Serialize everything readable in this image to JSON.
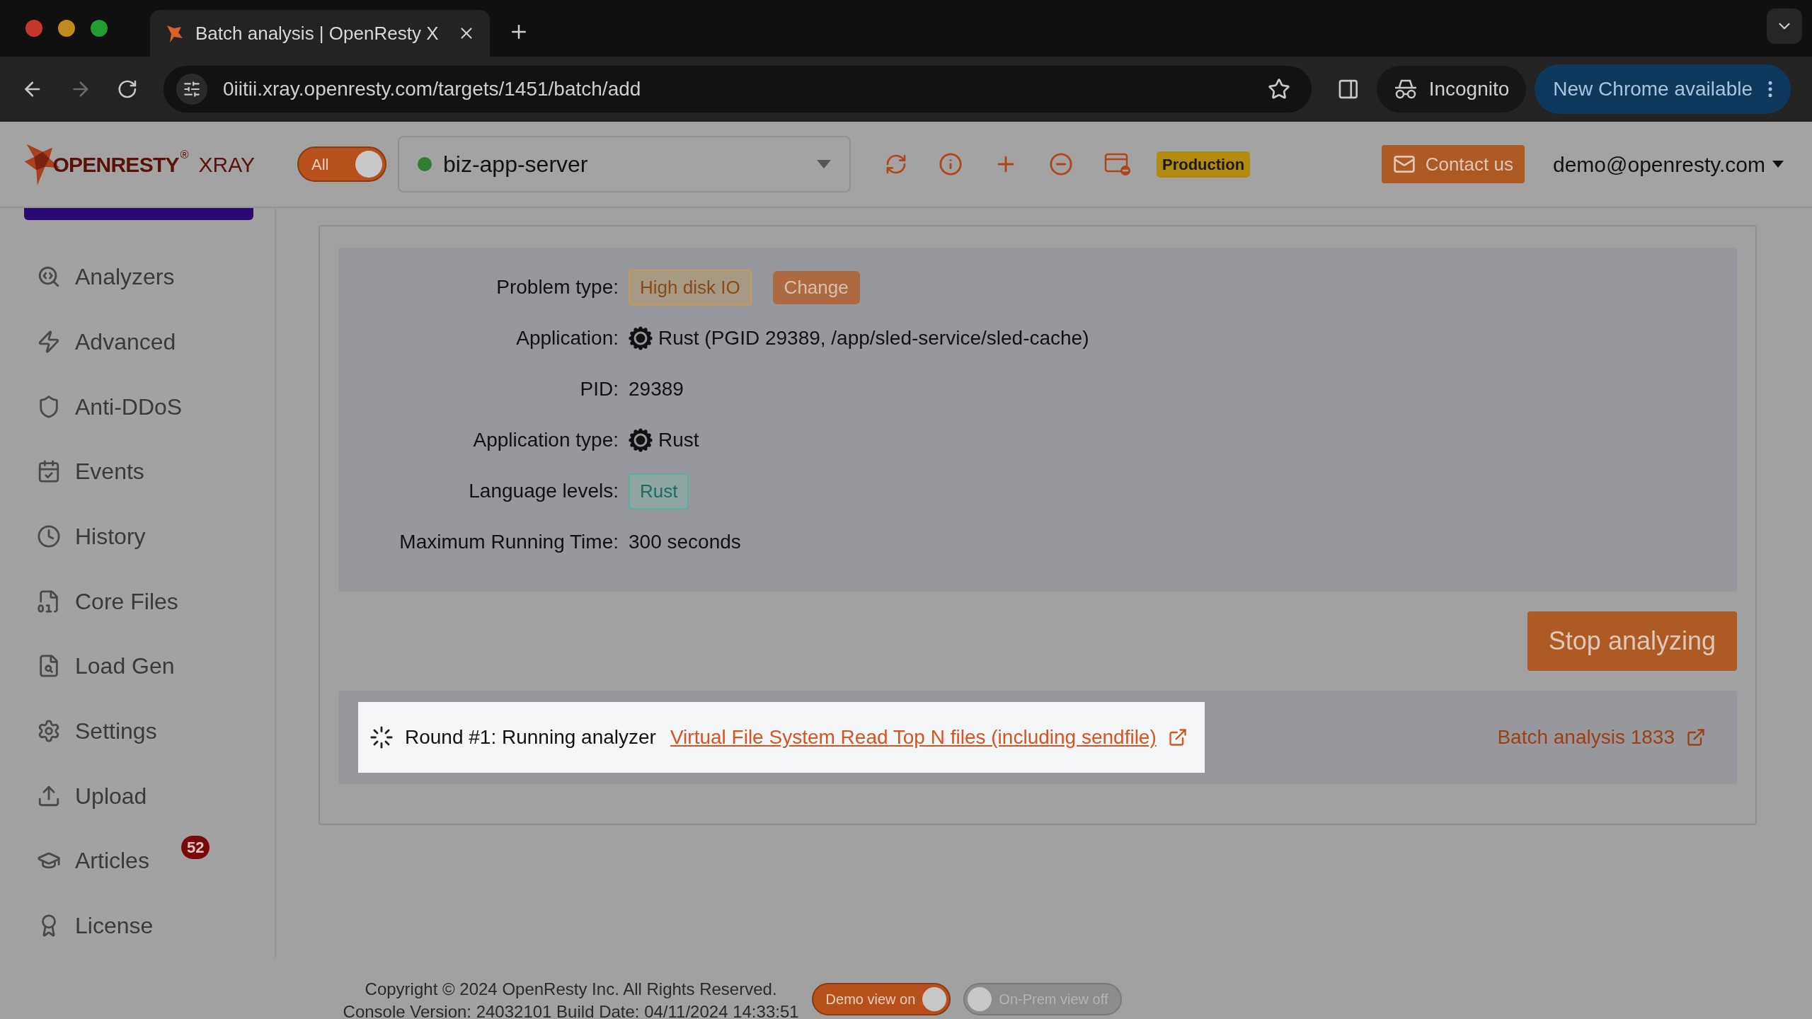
{
  "browser": {
    "tab_title": "Batch analysis | OpenResty X",
    "url": "0iitii.xray.openresty.com/targets/1451/batch/add",
    "profile": "Incognito",
    "update_button": "New Chrome available"
  },
  "header": {
    "logo": {
      "brand": "OPENRESTY",
      "mark": "®",
      "product": "XRAY"
    },
    "scope_toggle": {
      "label": "All",
      "on": true
    },
    "server": {
      "name": "biz-app-server",
      "color": "#2e7d32"
    },
    "environment": "Production",
    "contact": "Contact us",
    "user": "demo@openresty.com"
  },
  "sidebar": {
    "items": [
      {
        "label": "Analyzers"
      },
      {
        "label": "Advanced"
      },
      {
        "label": "Anti-DDoS"
      },
      {
        "label": "Events"
      },
      {
        "label": "History"
      },
      {
        "label": "Core Files"
      },
      {
        "label": "Load Gen"
      },
      {
        "label": "Settings"
      },
      {
        "label": "Upload"
      },
      {
        "label": "Articles",
        "badge": "52"
      },
      {
        "label": "License"
      }
    ]
  },
  "details": [
    {
      "label": "Problem type:",
      "kind": "warning_tag",
      "value": "High disk IO",
      "action": "Change"
    },
    {
      "label": "Application:",
      "kind": "lang_icon",
      "value": "Rust (PGID 29389, /app/sled-service/sled-cache)"
    },
    {
      "label": "PID:",
      "kind": "text",
      "value": "29389"
    },
    {
      "label": "Application type:",
      "kind": "lang_icon",
      "value": "Rust"
    },
    {
      "label": "Language levels:",
      "kind": "lang_tag",
      "value": "Rust"
    },
    {
      "label": "Maximum Running Time:",
      "kind": "text",
      "value": "300 seconds"
    }
  ],
  "stop_button": "Stop analyzing",
  "progress": {
    "highlighted": true,
    "status": "Round #1: Running analyzer",
    "analyzer_link": "Virtual File System Read Top N files (including sendfile)",
    "batch_link": "Batch analysis 1833"
  },
  "footer": {
    "copyright": "Copyright © 2024 OpenResty Inc. All Rights Reserved.",
    "version": "Console Version: 24032101 Build Date: 04/11/2024 14:33:51",
    "toggles": [
      {
        "label": "Demo view on",
        "on": true
      },
      {
        "label": "On-Prem view off",
        "on": false
      }
    ]
  }
}
